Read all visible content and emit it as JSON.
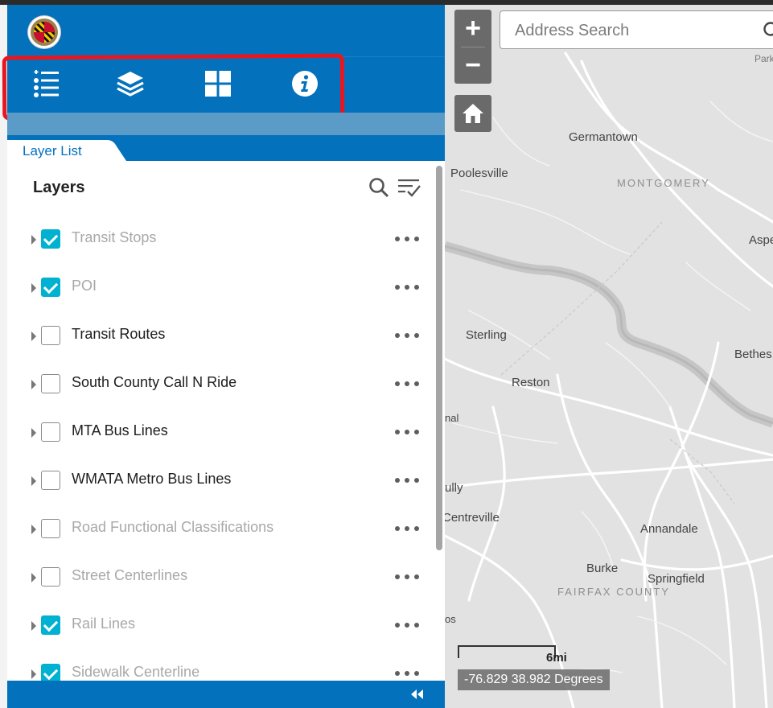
{
  "toolbar": {
    "icons": [
      "layer-list-icon",
      "layers-stack-icon",
      "widgets-grid-icon",
      "about-info-icon"
    ]
  },
  "panel": {
    "tab_label": "Layer List",
    "title": "Layers",
    "layers": [
      {
        "label": "Transit Stops",
        "checked": true,
        "dimmed": true
      },
      {
        "label": "POI",
        "checked": true,
        "dimmed": true
      },
      {
        "label": "Transit Routes",
        "checked": false,
        "dimmed": false
      },
      {
        "label": "South County Call N Ride",
        "checked": false,
        "dimmed": false
      },
      {
        "label": "MTA Bus Lines",
        "checked": false,
        "dimmed": false
      },
      {
        "label": "WMATA Metro Bus Lines",
        "checked": false,
        "dimmed": false
      },
      {
        "label": "Road Functional Classifications",
        "checked": false,
        "dimmed": true
      },
      {
        "label": "Street Centerlines",
        "checked": false,
        "dimmed": true
      },
      {
        "label": "Rail Lines",
        "checked": true,
        "dimmed": true
      },
      {
        "label": "Sidewalk Centerline",
        "checked": true,
        "dimmed": true
      }
    ]
  },
  "map": {
    "zoom_in": "+",
    "zoom_out": "−",
    "search_placeholder": "Address Search",
    "labels": {
      "germantown": "Germantown",
      "poolesville": "Poolesville",
      "montgomery": "MONTGOMERY",
      "aspen": "Aspe",
      "parks": "Park",
      "sterling": "Sterling",
      "reston": "Reston",
      "bethesda": "Bethes",
      "nal": "nal",
      "ully": "ully",
      "centreville": "Centreville",
      "annandale": "Annandale",
      "burke": "Burke",
      "springfield": "Springfield",
      "fairfax_county": "FAIRFAX COUNTY",
      "os": "os"
    },
    "scale_label": "6mi",
    "coordinates": "-76.829 38.982 Degrees"
  },
  "colors": {
    "header_blue": "#0471bd",
    "highlight_red": "#e8171f",
    "checkbox_teal": "#00b1d2"
  }
}
